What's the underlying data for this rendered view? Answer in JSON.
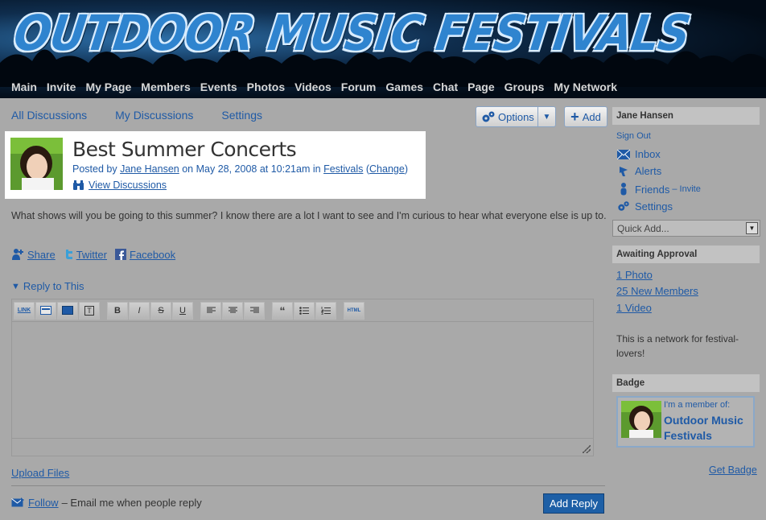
{
  "site": {
    "title": "OUTDOOR MUSIC FESTIVALS",
    "nav": [
      "Main",
      "Invite",
      "My Page",
      "Members",
      "Events",
      "Photos",
      "Videos",
      "Forum",
      "Games",
      "Chat",
      "Page",
      "Groups",
      "My Network"
    ]
  },
  "subnav": {
    "all_discussions": "All Discussions",
    "my_discussions": "My Discussions",
    "settings": "Settings",
    "options": "Options",
    "add": "Add"
  },
  "post": {
    "title": "Best Summer Concerts",
    "posted_by_prefix": "Posted by",
    "author": "Jane Hansen",
    "date_text": "on May 28, 2008 at 10:21am in",
    "category": "Festivals",
    "change": "Change",
    "view_discussions": "View Discussions",
    "body": "What shows will you be going to this summer? I know there are a lot I want to see and I'm curious to hear what everyone else is up to."
  },
  "share": {
    "share": "Share",
    "twitter": "Twitter",
    "facebook": "Facebook"
  },
  "reply": {
    "heading": "Reply to This",
    "toolbar": [
      "LINK",
      "img",
      "vid",
      "T",
      "B",
      "I",
      "S",
      "U",
      "left",
      "center",
      "right",
      "quote",
      "ul",
      "ol",
      "HTML"
    ],
    "upload_files": "Upload Files",
    "follow": "Follow",
    "follow_desc": "– Email me when people reply",
    "add_reply": "Add Reply"
  },
  "sidebar": {
    "user_name": "Jane Hansen",
    "sign_out": "Sign Out",
    "inbox": "Inbox",
    "alerts": "Alerts",
    "friends": "Friends",
    "friends_invite": "– Invite",
    "settings": "Settings",
    "quick_add": "Quick Add...",
    "awaiting_approval": "Awaiting Approval",
    "approvals": [
      "1 Photo",
      "25 New Members",
      "1 Video"
    ],
    "network_desc": "This is a network for festival-lovers!",
    "badge_heading": "Badge",
    "badge_member_of": "I'm a member of:",
    "badge_network": "Outdoor Music Festivals",
    "get_badge": "Get Badge"
  },
  "colors": {
    "link": "#1f5aa6",
    "page_bg": "#a9a9a9",
    "header_bg": "#020b16",
    "title_blue": "#2f84cf",
    "button_blue": "#1d5fa6"
  }
}
